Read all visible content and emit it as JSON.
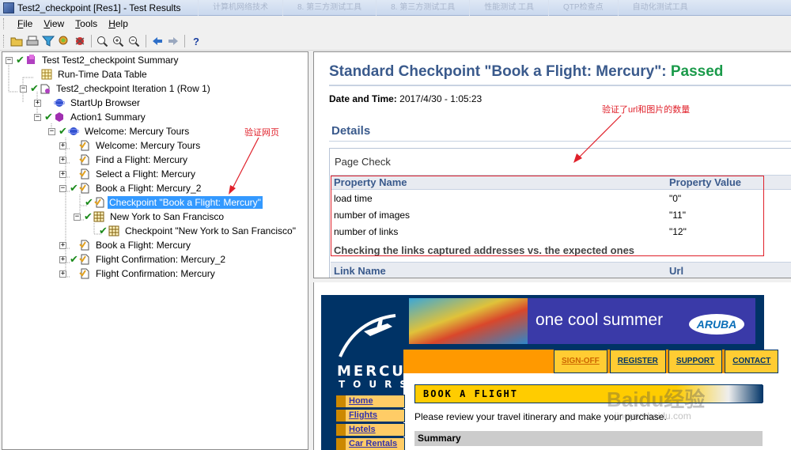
{
  "window": {
    "title": "Test2_checkpoint [Res1] - Test Results",
    "background_tabs": [
      "计算机网络技术",
      "8. 第三方测试工具",
      "8. 第三方测试工具",
      "性能测试 工具",
      "QTP检查点",
      "自动化测试工具"
    ]
  },
  "menu": {
    "file": "File",
    "view": "View",
    "tools": "Tools",
    "help": "Help",
    "file_key": "F",
    "view_key": "V",
    "tools_key": "T",
    "help_key": "H",
    "file_rest": "ile",
    "view_rest": "iew",
    "tools_rest": "ools",
    "help_rest": "elp"
  },
  "toolbar": {
    "icons": [
      "open-icon",
      "print-icon",
      "filter-icon",
      "find-icon",
      "bug-icon",
      "zoom-fit-icon",
      "zoom-in-icon",
      "zoom-out-icon",
      "back-icon",
      "forward-icon",
      "help-icon"
    ]
  },
  "tree": {
    "summary": "Test Test2_checkpoint Summary",
    "runtime_table": "Run-Time Data Table",
    "iteration": "Test2_checkpoint Iteration 1 (Row 1)",
    "startup": "StartUp Browser",
    "action1": "Action1 Summary",
    "welcome_browser": "Welcome: Mercury Tours",
    "welcome_page": "Welcome: Mercury Tours",
    "find_flight": "Find a Flight: Mercury",
    "select_flight": "Select a Flight: Mercury",
    "book_flight_2": "Book a Flight: Mercury_2",
    "checkpoint_book": "Checkpoint \"Book a Flight: Mercury\"",
    "ny_sf": "New York to San Francisco",
    "checkpoint_ny": "Checkpoint \"New York to San Francisco\"",
    "book_flight": "Book a Flight: Mercury",
    "confirm_2": "Flight Confirmation: Mercury_2",
    "confirm": "Flight Confirmation: Mercury"
  },
  "annotations": {
    "verify_page": "验证网页",
    "verify_counts": "验证了url和图片的数量"
  },
  "report": {
    "title_prefix": "Standard Checkpoint \"Book a Flight: Mercury\": ",
    "status": "Passed",
    "datetime_label": "Date and Time:",
    "datetime_value": " 2017/4/30 - 1:05:23",
    "details": "Details",
    "page_check": "Page Check",
    "col_property_name": "Property Name",
    "col_property_value": "Property Value",
    "properties": [
      {
        "name": "load time",
        "value": "\"0\""
      },
      {
        "name": "number of images",
        "value": "\"11\""
      },
      {
        "name": "number of links",
        "value": "\"12\""
      }
    ],
    "links_check": "Checking the links captured addresses vs. the expected ones",
    "col_link_name": "Link Name",
    "col_url": "Url"
  },
  "snapshot": {
    "logo_line1": "MERCURY",
    "logo_line2": "TOURS",
    "banner_text": "one cool summer",
    "banner_brand": "ARUBA",
    "top_links": [
      "SIGN-OFF",
      "REGISTER",
      "SUPPORT",
      "CONTACT"
    ],
    "nav_links": [
      "Home",
      "Flights",
      "Hotels",
      "Car Rentals"
    ],
    "section_title": "BOOK A FLIGHT",
    "review_text": "Please review your travel itinerary and make your purchase.",
    "summary": "Summary",
    "watermark": "Baidu经验",
    "watermark_url": "jingyan.baidu.com"
  },
  "colors": {
    "report_title": "#3a5a8c",
    "passed": "#1a9a4a",
    "annotation": "#e0202a",
    "selected": "#3399ff",
    "mercury_navy": "#003366",
    "mercury_orange": "#ff9900"
  }
}
